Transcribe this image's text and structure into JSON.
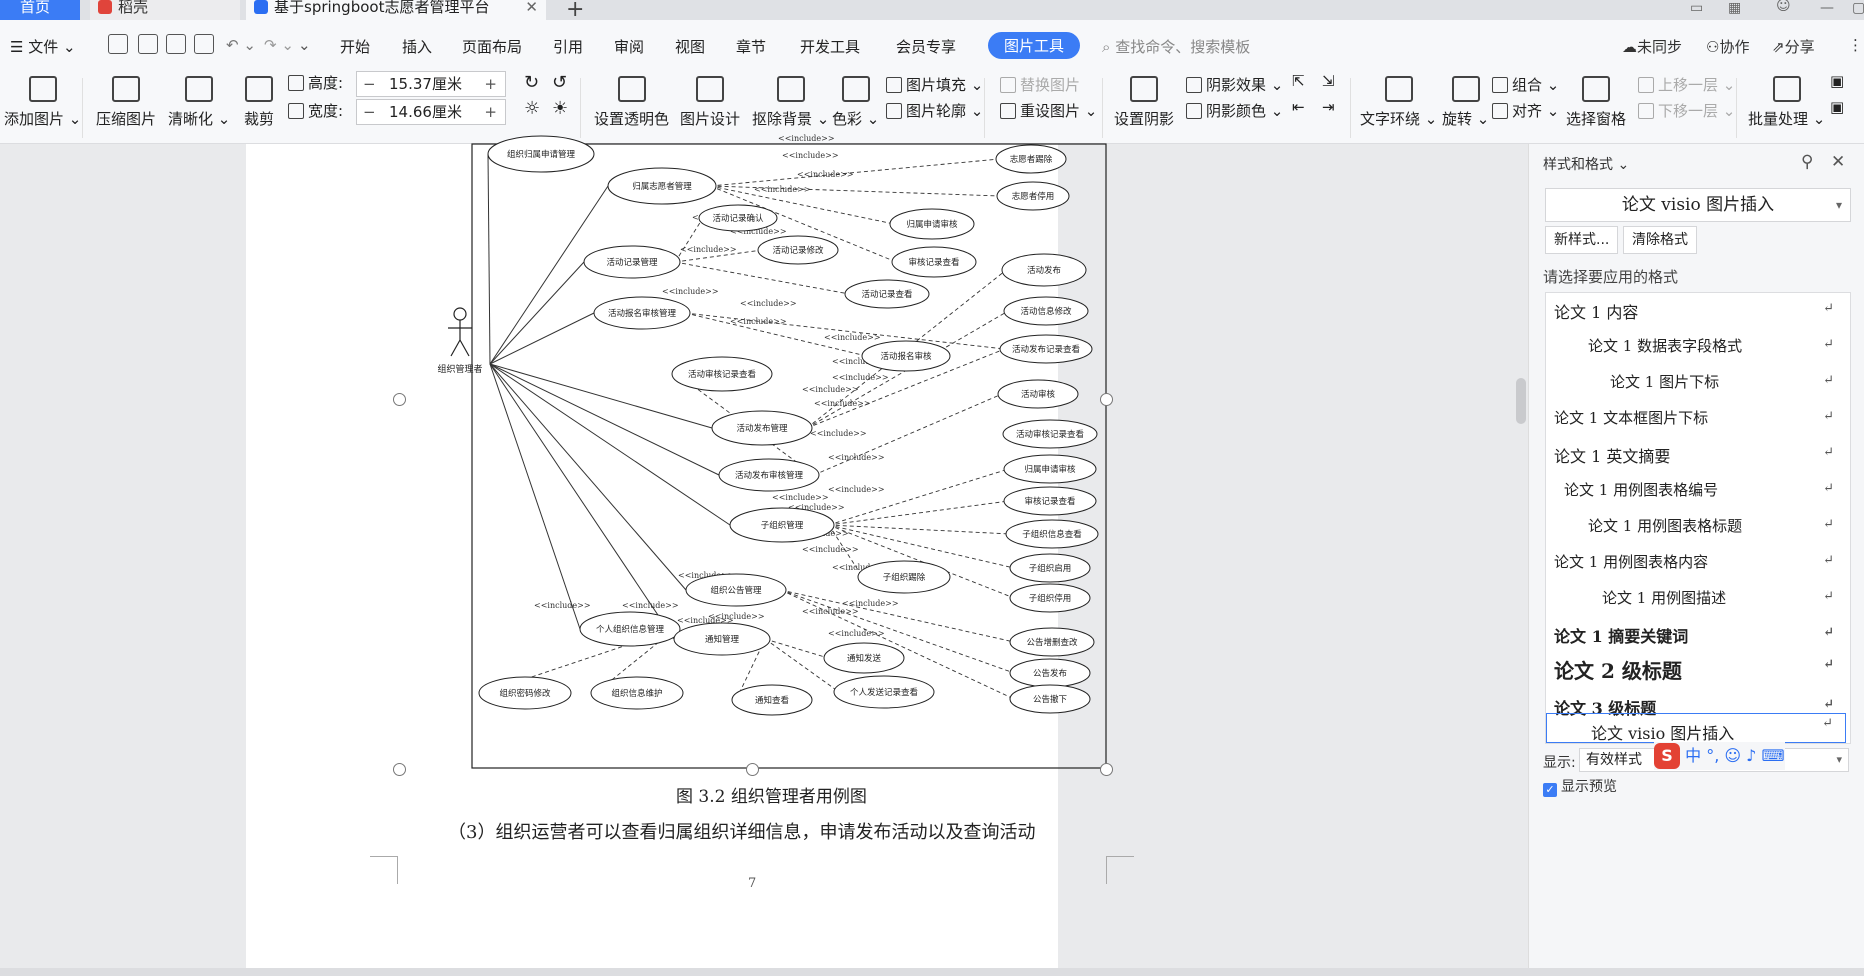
{
  "tabs": {
    "home": "首页",
    "daoke": "稻壳",
    "doc": "基于springboot志愿者管理平台"
  },
  "menu": {
    "file": "文件",
    "items": [
      "开始",
      "插入",
      "页面布局",
      "引用",
      "审阅",
      "视图",
      "章节",
      "开发工具",
      "会员专享"
    ],
    "active": "图片工具",
    "search_placeholder": "查找命令、搜索模板",
    "sync": "未同步",
    "collab": "协作",
    "share": "分享"
  },
  "toolbar": {
    "add_image": "添加图片",
    "compress": "压缩图片",
    "sharpen": "清晰化",
    "crop": "裁剪",
    "height_label": "高度:",
    "height_value": "15.37厘米",
    "width_label": "宽度:",
    "width_value": "14.66厘米",
    "set_transparent": "设置透明色",
    "image_design": "图片设计",
    "remove_bg": "抠除背景",
    "color": "色彩",
    "image_fill": "图片填充",
    "image_outline": "图片轮廓",
    "replace_image": "替换图片",
    "reset_image": "重设图片",
    "set_shadow": "设置阴影",
    "shadow_effect": "阴影效果",
    "shadow_color": "阴影颜色",
    "text_wrap": "文字环绕",
    "rotate": "旋转",
    "group": "组合",
    "align": "对齐",
    "select_pane": "选择窗格",
    "bring_forward": "上移一层",
    "send_backward": "下移一层",
    "batch": "批量处理"
  },
  "document": {
    "caption": "图 3.2  组织管理者用例图",
    "paragraph": "（3）组织运营者可以查看归属组织详细信息，申请发布活动以及查询活动",
    "page_number": "7",
    "diagram": {
      "actor": "组织管理者",
      "include": "<<include>>",
      "use_cases": [
        "组织归属申请管理",
        "归属志愿者管理",
        "志愿者踢除",
        "志愿者停用",
        "活动记录确认",
        "活动记录修改",
        "归属申请审核",
        "活动记录管理",
        "审核记录查看",
        "活动记录查看",
        "活动发布",
        "活动报名审核管理",
        "活动信息修改",
        "活动报名审核",
        "活动发布记录查看",
        "活动审核记录查看",
        "活动审核",
        "活动发布管理",
        "活动审核记录查看",
        "活动发布审核管理",
        "归属申请审核",
        "子组织管理",
        "审核记录查看",
        "子组织信息查看",
        "子组织踢除",
        "子组织启用",
        "子组织停用",
        "组织公告管理",
        "个人组织信息管理",
        "通知管理",
        "通知发送",
        "公告增删查改",
        "公告发布",
        "组织密码修改",
        "组织信息维护",
        "通知查看",
        "个人发送记录查看",
        "公告撤下"
      ]
    }
  },
  "panel": {
    "title": "样式和格式",
    "current_style": "论文 visio 图片插入",
    "new_style": "新样式...",
    "clear_format": "清除格式",
    "choose_label": "请选择要应用的格式",
    "styles": [
      "论文 1 内容",
      "论文 1 数据表字段格式",
      "论文 1 图片下标",
      "论文 1 文本框图片下标",
      "论文 1 英文摘要",
      "论文 1 用例图表格编号",
      "论文 1 用例图表格标题",
      "论文 1 用例图表格内容",
      "论文 1 用例图描述",
      "论文 1 摘要关键词",
      "论文 2 级标题",
      "论文 3 级标题",
      "论文 visio 图片插入"
    ],
    "show_label": "显示:",
    "show_value": "有效样式",
    "preview_label": "显示预览"
  },
  "ime": {
    "logo": "S",
    "lang": "中"
  }
}
